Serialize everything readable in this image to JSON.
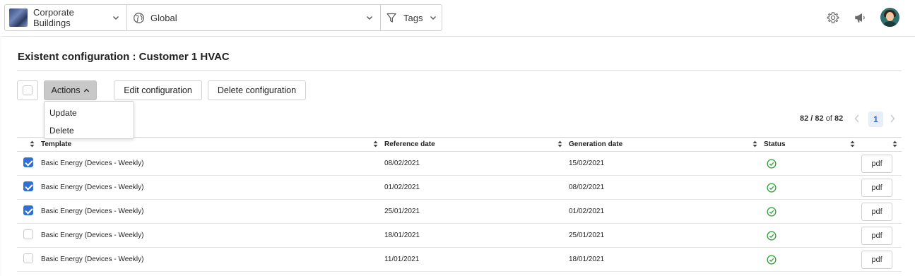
{
  "header": {
    "site_label": "Corporate Buildings",
    "scope_label": "Global",
    "tags_label": "Tags"
  },
  "page": {
    "title": "Existent configuration : Customer 1 HVAC"
  },
  "toolbar": {
    "actions_label": "Actions",
    "edit_label": "Edit configuration",
    "delete_label": "Delete configuration"
  },
  "actions_menu": {
    "items": [
      "Update",
      "Delete"
    ]
  },
  "pagination": {
    "shown": "82",
    "separator": " / ",
    "total_a": "82",
    "of_label": " of ",
    "total_b": "82",
    "current_page": "1"
  },
  "table": {
    "columns": [
      "Template",
      "Reference date",
      "Generation date",
      "Status"
    ],
    "rows": [
      {
        "selected": true,
        "template": "Basic Energy (Devices - Weekly)",
        "reference_date": "08/02/2021",
        "generation_date": "15/02/2021",
        "status": "ok",
        "action": "pdf"
      },
      {
        "selected": true,
        "template": "Basic Energy (Devices - Weekly)",
        "reference_date": "01/02/2021",
        "generation_date": "08/02/2021",
        "status": "ok",
        "action": "pdf"
      },
      {
        "selected": true,
        "template": "Basic Energy (Devices - Weekly)",
        "reference_date": "25/01/2021",
        "generation_date": "01/02/2021",
        "status": "ok",
        "action": "pdf"
      },
      {
        "selected": false,
        "template": "Basic Energy (Devices - Weekly)",
        "reference_date": "18/01/2021",
        "generation_date": "25/01/2021",
        "status": "ok",
        "action": "pdf"
      },
      {
        "selected": false,
        "template": "Basic Energy (Devices - Weekly)",
        "reference_date": "11/01/2021",
        "generation_date": "18/01/2021",
        "status": "ok",
        "action": "pdf"
      }
    ]
  },
  "colors": {
    "accent": "#2f6fd6",
    "status_ok": "#3aa33f",
    "actions_button_bg": "#c8c8c8"
  },
  "icons": {
    "settings": "gear-icon",
    "announcements": "megaphone-icon",
    "scope": "globe-icon",
    "tags": "funnel-icon",
    "status": "check-circle-icon"
  }
}
